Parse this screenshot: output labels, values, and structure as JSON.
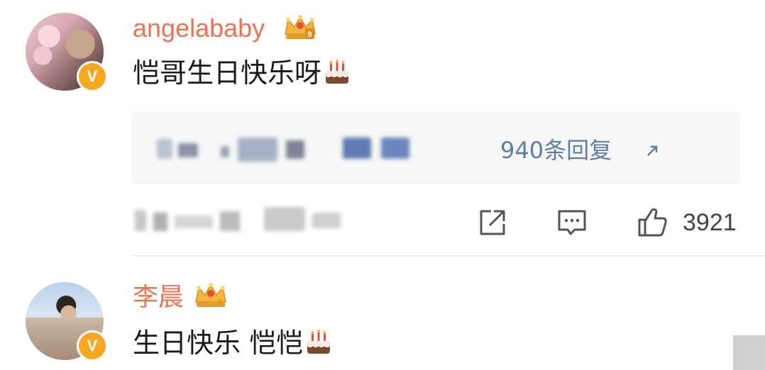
{
  "comments": [
    {
      "username": "angelababy",
      "text": "恺哥生日快乐呀",
      "crown_level": "9",
      "verified_badge": "V",
      "replies_label": "940条回复",
      "likes": "3921"
    },
    {
      "username": "李晨",
      "text": "生日快乐 恺恺",
      "crown_level": "7",
      "verified_badge": "V"
    }
  ],
  "icons": {
    "share": "share-icon",
    "comment": "comment-icon",
    "like": "thumbs-up-icon",
    "cake": "cake-emoji-icon",
    "crown": "crown-icon"
  },
  "colors": {
    "username": "#eb7350",
    "link": "#5d7ea8",
    "badge": "#f7a823",
    "reply_bg": "#f7f7f7"
  }
}
